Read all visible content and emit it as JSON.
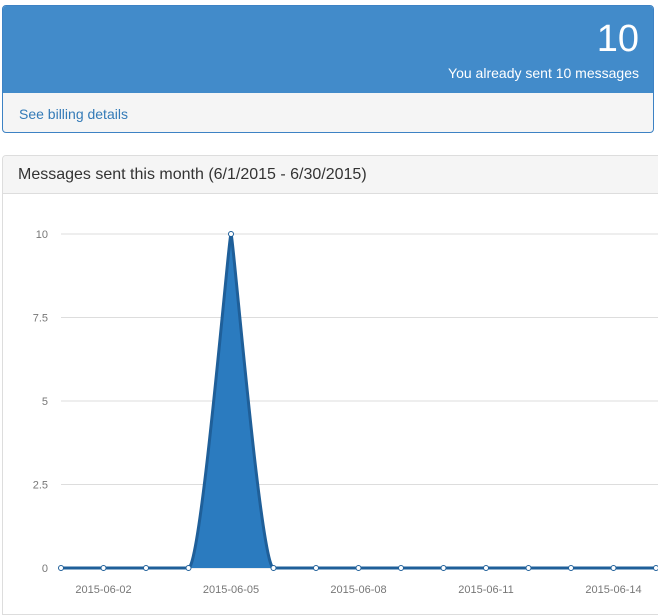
{
  "summary": {
    "count": "10",
    "caption": "You already sent 10 messages",
    "billing_link": "See billing details"
  },
  "colors": {
    "header_blue": "#428bca",
    "link_blue": "#337ab7",
    "series_fill": "#2b7bbf",
    "series_line": "#1f5f99"
  },
  "chart_data": {
    "type": "area",
    "title": "Messages sent this month (6/1/2015 - 6/30/2015)",
    "xlabel": "",
    "ylabel": "",
    "ylim": [
      0,
      10
    ],
    "grid": true,
    "y_ticks": [
      "0",
      "2.5",
      "5",
      "7.5",
      "10"
    ],
    "y_tick_values": [
      0,
      2.5,
      5,
      7.5,
      10
    ],
    "x_tick_labels": [
      "2015-06-02",
      "2015-06-05",
      "2015-06-08",
      "2015-06-11",
      "2015-06-14"
    ],
    "x_tick_dates": [
      "2015-06-02",
      "2015-06-05",
      "2015-06-08",
      "2015-06-11",
      "2015-06-14"
    ],
    "x_visible_range": [
      "2015-06-01",
      "2015-06-15"
    ],
    "series": [
      {
        "x": [
          "2015-06-01",
          "2015-06-02",
          "2015-06-03",
          "2015-06-04",
          "2015-06-05",
          "2015-06-06",
          "2015-06-07",
          "2015-06-08",
          "2015-06-09",
          "2015-06-10",
          "2015-06-11",
          "2015-06-12",
          "2015-06-13",
          "2015-06-14",
          "2015-06-15"
        ],
        "values": [
          0,
          0,
          0,
          0,
          10,
          0,
          0,
          0,
          0,
          0,
          0,
          0,
          0,
          0,
          0
        ]
      }
    ]
  }
}
